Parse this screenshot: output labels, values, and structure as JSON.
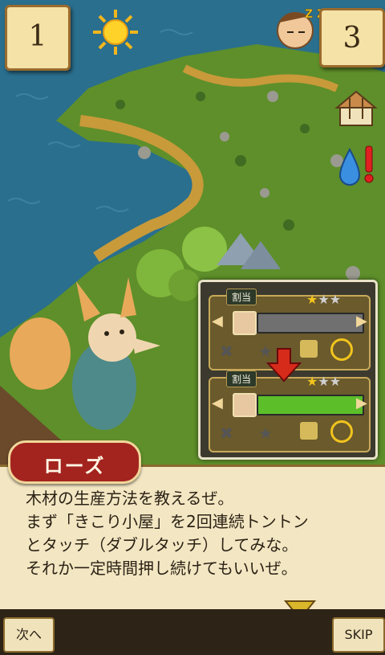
{
  "hud": {
    "day_count": "1",
    "sleep_count": "3",
    "sleep_label": "Z Z Z"
  },
  "panel": {
    "slot_label": "割当",
    "slot_top": {
      "stars_filled": 1,
      "stars_total": 3,
      "assigned_fraction": 0
    },
    "slot_bottom": {
      "stars_filled": 1,
      "stars_total": 3,
      "assigned_fraction": 1
    }
  },
  "dialog": {
    "speaker": "ローズ",
    "text": "木材の生産方法を教えるぜ。\nまず「きこり小屋」を2回連続トントン\nとタッチ（ダブルタッチ）してみな。\nそれか一定時間押し続けてもいいぜ。"
  },
  "buttons": {
    "next": "次へ",
    "skip": "SKIP"
  },
  "colors": {
    "sea": "#2a6f8e",
    "grass": "#5e8f2a",
    "parchment": "#f3e7c3",
    "bar_active": "#5cbf2a",
    "bar_inactive": "#707070",
    "name_tag": "#a3241f"
  }
}
